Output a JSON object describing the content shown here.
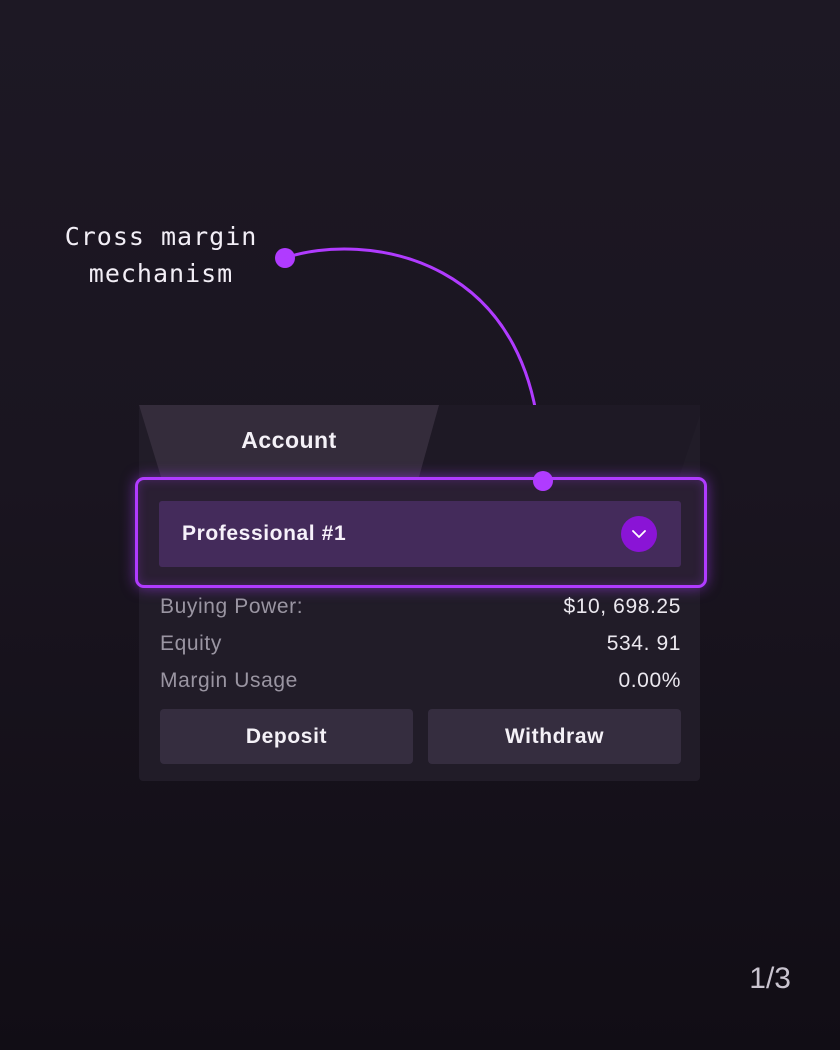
{
  "annotation": {
    "line1": "Cross margin",
    "line2": "mechanism"
  },
  "card": {
    "tab_label": "Account",
    "account_select": {
      "selected": "Professional #1",
      "icon": "chevron-down-icon"
    },
    "stats": [
      {
        "label": "Buying Power:",
        "value": "$10, 698.25"
      },
      {
        "label": "Equity",
        "value": "534. 91"
      },
      {
        "label": "Margin Usage",
        "value": "0.00%"
      }
    ],
    "actions": {
      "deposit_label": "Deposit",
      "withdraw_label": "Withdraw"
    }
  },
  "pagination": {
    "indicator": "1/3"
  },
  "colors": {
    "accent": "#b03bff",
    "select_bg": "#442b5b",
    "chevron_bg": "#8a14d6",
    "card_bg": "#211c28",
    "button_bg": "#352d3f"
  }
}
